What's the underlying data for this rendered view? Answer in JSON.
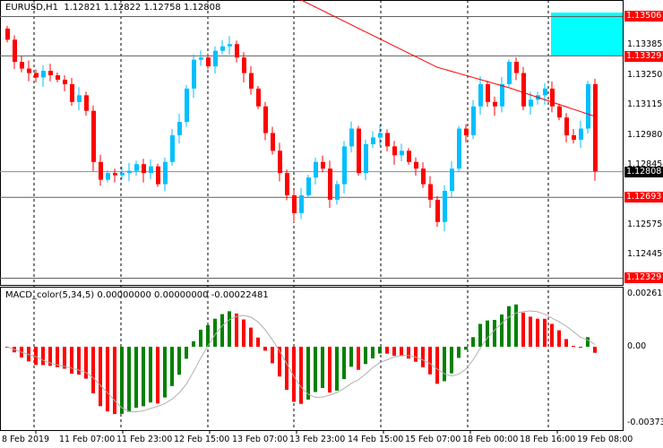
{
  "header": {
    "symbol": "EURUSD,H1",
    "open": "1.12821",
    "high": "1.12822",
    "low": "1.12758",
    "close": "1.12808"
  },
  "macd_header": {
    "name": "MACD_color(5,34,5)",
    "v1": "0.00000000",
    "v2": "0.00000000",
    "v3": "-0.00022481"
  },
  "price_axis": [
    "1.13385",
    "1.13250",
    "1.13115",
    "1.12980",
    "1.12845",
    "1.12575",
    "1.12445"
  ],
  "price_tags": {
    "upper_zone": "1.13506",
    "zone_low": "1.13329",
    "current": "1.12808",
    "support": "1.12693",
    "low": "1.12329"
  },
  "macd_axis": {
    "top": "0.0026195",
    "zero": "0.00",
    "bottom": "-0.003738"
  },
  "time_axis": [
    "8 Feb 2019",
    "11 Feb 07:00",
    "11 Feb 23:00",
    "12 Feb 15:00",
    "13 Feb 07:00",
    "13 Feb 23:00",
    "14 Feb 15:00",
    "15 Feb 07:00",
    "18 Feb 00:00",
    "18 Feb 16:00",
    "19 Feb 08:00"
  ],
  "colors": {
    "bull": "#00bfff",
    "bear": "#ff0000",
    "macd_up": "#008000",
    "macd_down": "#ff0000",
    "zone": "#00ffff",
    "ma": "#ff0000"
  },
  "chart_data": {
    "type": "candlestick",
    "closes": [
      1.134,
      1.133,
      1.1327,
      1.1325,
      1.1323,
      1.1326,
      1.1324,
      1.1322,
      1.132,
      1.1312,
      1.1315,
      1.1308,
      1.1285,
      1.1277,
      1.128,
      1.1279,
      1.128,
      1.1281,
      1.1284,
      1.128,
      1.1283,
      1.1275,
      1.1285,
      1.1297,
      1.1303,
      1.1318,
      1.1331,
      1.1332,
      1.1328,
      1.1335,
      1.1337,
      1.1338,
      1.1332,
      1.1325,
      1.1318,
      1.131,
      1.1298,
      1.129,
      1.128,
      1.127,
      1.1262,
      1.127,
      1.1278,
      1.1285,
      1.1282,
      1.1268,
      1.1275,
      1.1292,
      1.13,
      1.128,
      1.1293,
      1.1296,
      1.1298,
      1.1292,
      1.1288,
      1.129,
      1.1285,
      1.1282,
      1.1275,
      1.1268,
      1.1258,
      1.1272,
      1.1282,
      1.13,
      1.1297,
      1.131,
      1.132,
      1.1312,
      1.131,
      1.132,
      1.133,
      1.1325,
      1.131,
      1.1313,
      1.1315,
      1.1318,
      1.131,
      1.1305,
      1.1297,
      1.1295,
      1.13,
      1.132,
      1.12808
    ],
    "first_open": 1.1345,
    "ma_points": [
      [
        41,
        1.13579
      ],
      [
        60,
        1.13276
      ],
      [
        70,
        1.13184
      ],
      [
        82,
        1.13055
      ]
    ],
    "levels": [
      1.13506,
      1.13329,
      1.12808,
      1.12693,
      1.12329
    ],
    "zone": [
      1.13506,
      1.13329
    ],
    "price_range": [
      1.12329,
      1.13506
    ],
    "macd_range": [
      -0.003738,
      0.0026195
    ]
  }
}
